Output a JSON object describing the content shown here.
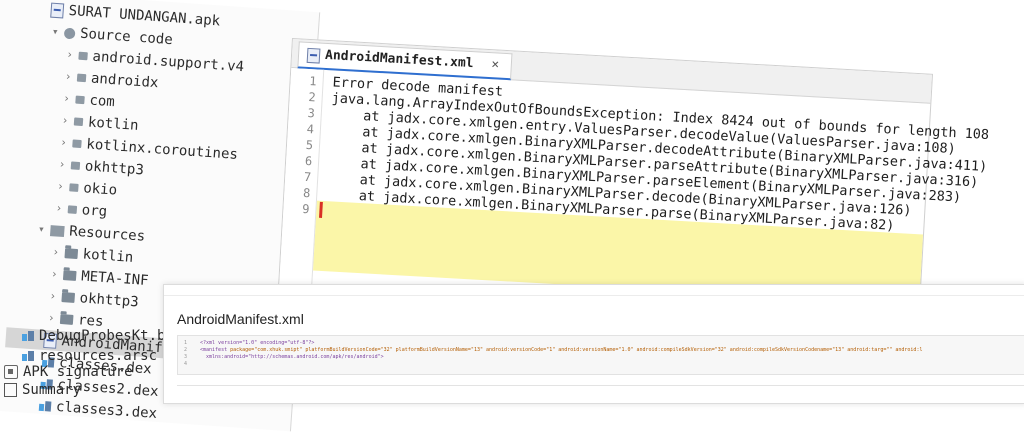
{
  "tree": {
    "root_label": "SURAT UNDANGAN.apk",
    "source_code_label": "Source code",
    "packages": [
      "android.support.v4",
      "androidx",
      "com",
      "kotlin",
      "kotlinx.coroutines",
      "okhttp3",
      "okio",
      "org"
    ],
    "resources_label": "Resources",
    "resource_folders": [
      "kotlin",
      "META-INF",
      "okhttp3",
      "res"
    ],
    "manifest_label": "AndroidManifest.xml",
    "dex_files": [
      "classes.dex",
      "classes2.dex",
      "classes3.dex"
    ],
    "other_files": [
      "DebugProbesKt.bi",
      "resources.arsc"
    ],
    "apk_signature_label": "APK signature",
    "summary_label": "Summary"
  },
  "editor": {
    "tab_label": "AndroidManifest.xml",
    "tab_close": "×",
    "line_numbers": [
      "1",
      "2",
      "3",
      "4",
      "5",
      "6",
      "7",
      "8",
      "9"
    ],
    "lines": [
      "Error decode manifest",
      "java.lang.ArrayIndexOutOfBoundsException: Index 8424 out of bounds for length 108",
      "    at jadx.core.xmlgen.entry.ValuesParser.decodeValue(ValuesParser.java:108)",
      "    at jadx.core.xmlgen.BinaryXMLParser.decodeAttribute(BinaryXMLParser.java:411)",
      "    at jadx.core.xmlgen.BinaryXMLParser.parseAttribute(BinaryXMLParser.java:316)",
      "    at jadx.core.xmlgen.BinaryXMLParser.parseElement(BinaryXMLParser.java:283)",
      "    at jadx.core.xmlgen.BinaryXMLParser.decode(BinaryXMLParser.java:126)",
      "    at jadx.core.xmlgen.BinaryXMLParser.parse(BinaryXMLParser.java:82)",
      ""
    ]
  },
  "web": {
    "title": "AndroidManifest.xml",
    "code_line_numbers": [
      "1",
      "2",
      "3",
      "4"
    ],
    "code_line1": "<?xml version=\"1.0\" encoding=\"utf-8\"?>",
    "code_line2_tag": "<manifest ",
    "code_line2_attrs": "package=\"com.xhuk.smipt\" platformBuildVersionCode=\"32\" platformBuildVersionName=\"13\" android:versionCode=\"1\" android:versionName=\"1.0\" android:compileSdkVersion=\"32\" android:compileSdkVersionCodename=\"13\" android:targ=\"\" android:l",
    "code_line3": "  xmlns:android=\"http://schemas.android.com/apk/res/android\">"
  }
}
